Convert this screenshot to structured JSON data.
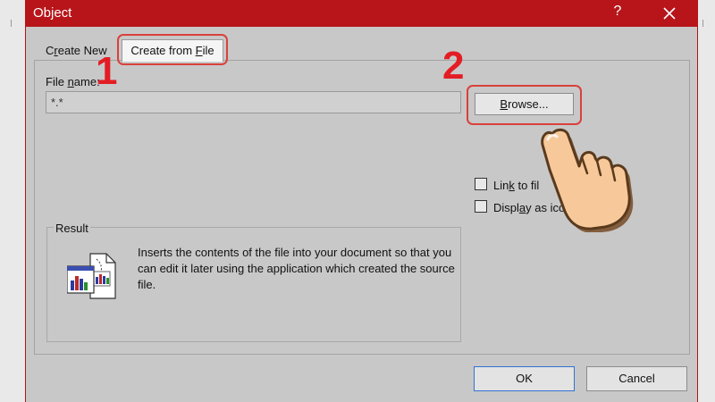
{
  "window": {
    "title": "Object",
    "help_label": "?"
  },
  "tabs": [
    {
      "label_pre": "C",
      "label_key": "r",
      "label_post": "eate New",
      "active": false
    },
    {
      "label_pre": "Create from ",
      "label_key": "F",
      "label_post": "ile",
      "active": true
    }
  ],
  "step_markers": {
    "one": "1",
    "two": "2"
  },
  "file_name": {
    "label_pre": "File ",
    "label_key": "n",
    "label_post": "ame:",
    "value": "*.*"
  },
  "browse_button": {
    "label_key": "B",
    "label_post": "rowse..."
  },
  "options": {
    "link": {
      "label_pre": "Lin",
      "label_key": "k",
      "label_post": " to fil",
      "checked": false
    },
    "display_icon": {
      "label_pre": "Displ",
      "label_key": "a",
      "label_post": "y as ico",
      "checked": false
    }
  },
  "result": {
    "legend": "Result",
    "text": "Inserts the contents of the file into your document so that you can edit it later using the application which created the source file.",
    "icon": "object-embed-icon"
  },
  "footer": {
    "ok_label": "OK",
    "cancel_label": "Cancel"
  },
  "colors": {
    "titlebar": "#b7151a",
    "annotation_red": "#e31d24",
    "highlight_border": "#d9413c",
    "hand_fill": "#f7c99a"
  },
  "icons": [
    "close-icon",
    "pointing-hand-icon",
    "object-embed-icon"
  ]
}
